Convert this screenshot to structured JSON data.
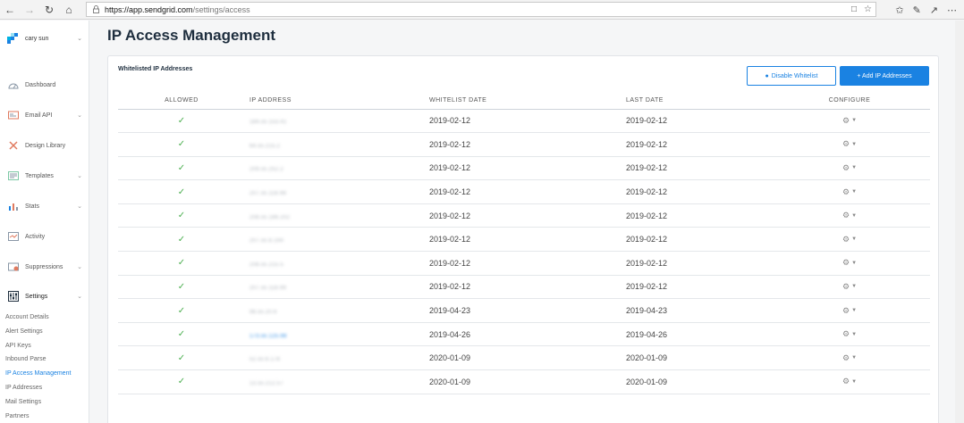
{
  "browser": {
    "url_host": "https://app.sendgrid.com",
    "url_path": "/settings/access"
  },
  "sidebar": {
    "user_name": "cary sun",
    "items": [
      {
        "label": "Dashboard",
        "icon": "dashboard-icon",
        "has_chevron": false
      },
      {
        "label": "Email API",
        "icon": "email-api-icon",
        "has_chevron": true
      },
      {
        "label": "Design Library",
        "icon": "design-library-icon",
        "has_chevron": false
      },
      {
        "label": "Templates",
        "icon": "templates-icon",
        "has_chevron": true
      },
      {
        "label": "Stats",
        "icon": "stats-icon",
        "has_chevron": true
      },
      {
        "label": "Activity",
        "icon": "activity-icon",
        "has_chevron": false
      },
      {
        "label": "Suppressions",
        "icon": "suppressions-icon",
        "has_chevron": true
      },
      {
        "label": "Settings",
        "icon": "settings-icon",
        "has_chevron": true
      }
    ],
    "subitems": [
      {
        "label": "Account Details",
        "active": false
      },
      {
        "label": "Alert Settings",
        "active": false
      },
      {
        "label": "API Keys",
        "active": false
      },
      {
        "label": "Inbound Parse",
        "active": false
      },
      {
        "label": "IP Access Management",
        "active": true
      },
      {
        "label": "IP Addresses",
        "active": false
      },
      {
        "label": "Mail Settings",
        "active": false
      },
      {
        "label": "Partners",
        "active": false
      }
    ]
  },
  "page": {
    "title": "IP Access Management",
    "card_title": "Whitelisted IP Addresses",
    "disable_button": "Disable Whitelist",
    "add_button": "+ Add IP Addresses"
  },
  "table": {
    "headers": {
      "allowed": "ALLOWED",
      "ip": "IP ADDRESS",
      "whitelist_date": "WHITELIST DATE",
      "last_date": "LAST DATE",
      "configure": "CONFIGURE"
    },
    "rows": [
      {
        "ip": "184.xx.153.41",
        "whitelist_date": "2019-02-12",
        "last_date": "2019-02-12",
        "link": false
      },
      {
        "ip": "64.xx.215.2",
        "whitelist_date": "2019-02-12",
        "last_date": "2019-02-12",
        "link": false
      },
      {
        "ip": "209.xx.252.2",
        "whitelist_date": "2019-02-12",
        "last_date": "2019-02-12",
        "link": false
      },
      {
        "ip": "207.xx.118.98",
        "whitelist_date": "2019-02-12",
        "last_date": "2019-02-12",
        "link": false
      },
      {
        "ip": "208.xx.186.202",
        "whitelist_date": "2019-02-12",
        "last_date": "2019-02-12",
        "link": false
      },
      {
        "ip": "207.xx.8.194",
        "whitelist_date": "2019-02-12",
        "last_date": "2019-02-12",
        "link": false
      },
      {
        "ip": "208.xx.215.5",
        "whitelist_date": "2019-02-12",
        "last_date": "2019-02-12",
        "link": false
      },
      {
        "ip": "207.xx.118.99",
        "whitelist_date": "2019-02-12",
        "last_date": "2019-02-12",
        "link": false
      },
      {
        "ip": "98.xx.20.6",
        "whitelist_date": "2019-04-23",
        "last_date": "2019-04-23",
        "link": false
      },
      {
        "ip": "173.xx.125.98",
        "whitelist_date": "2019-04-26",
        "last_date": "2019-04-26",
        "link": true
      },
      {
        "ip": "52.xx.6.178",
        "whitelist_date": "2020-01-09",
        "last_date": "2020-01-09",
        "link": false
      },
      {
        "ip": "13.xx.212.57",
        "whitelist_date": "2020-01-09",
        "last_date": "2020-01-09",
        "link": false
      }
    ]
  },
  "colors": {
    "accent": "#1a82e2",
    "check": "#4caf50",
    "title": "#1e2e3e"
  }
}
